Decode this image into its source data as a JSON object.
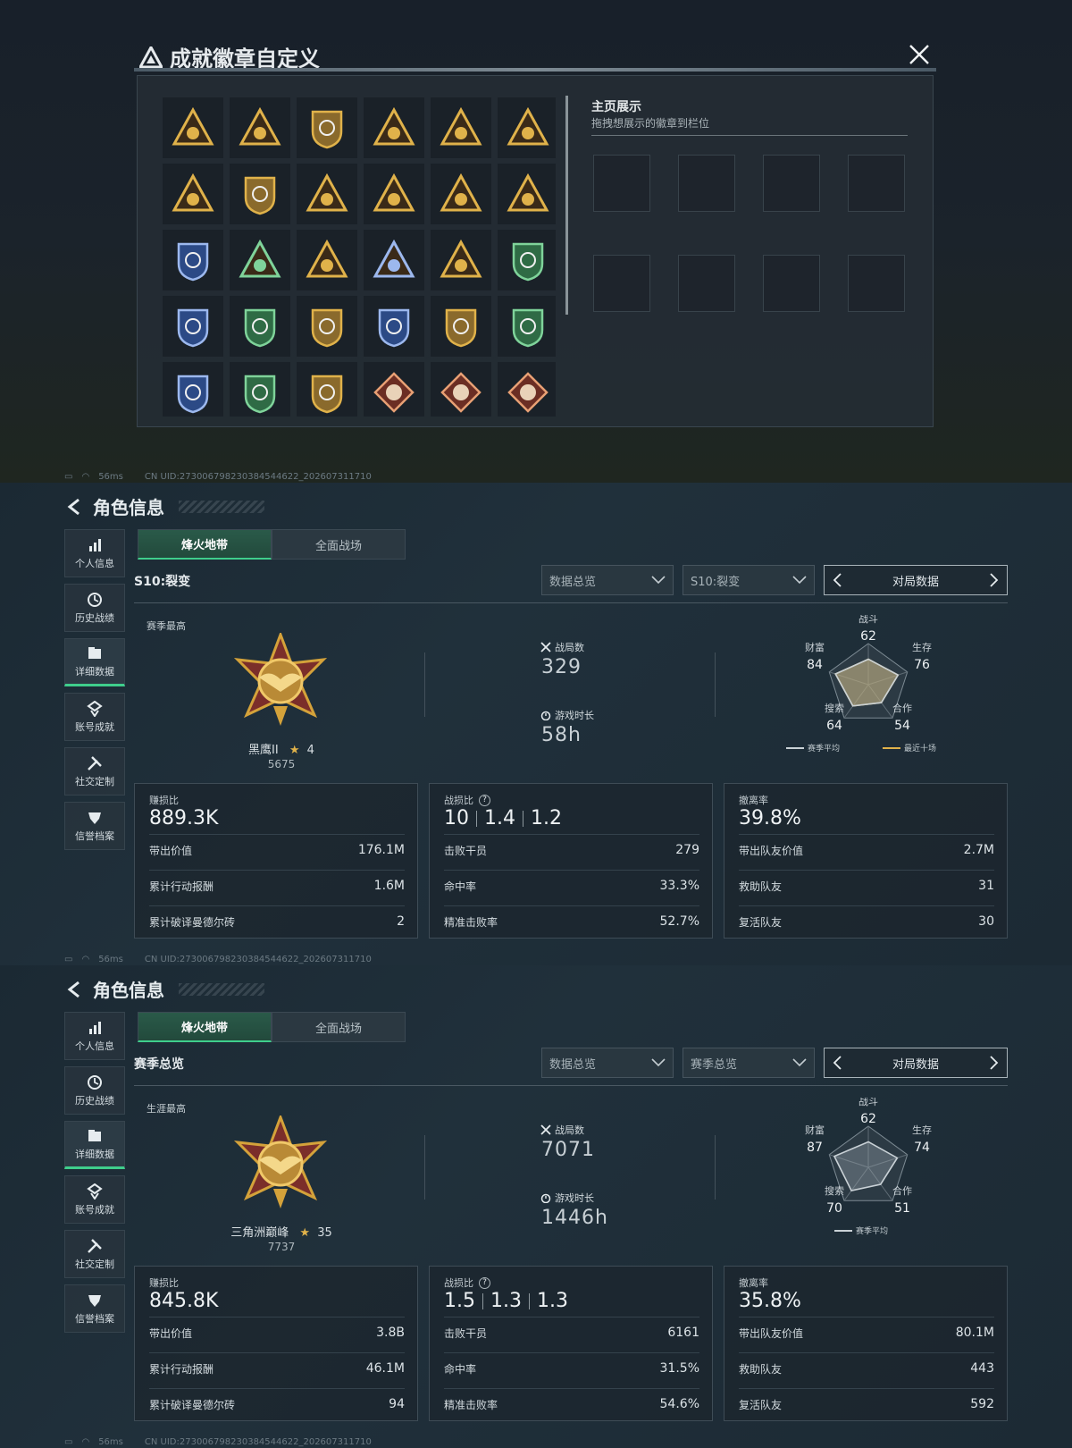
{
  "badge_modal": {
    "title": "成就徽章自定义",
    "home_title": "主页展示",
    "home_subtitle": "拖拽想展示的徽章到栏位",
    "badges": [
      "triangle-badge",
      "helicopter-badge",
      "crosshair-shield-badge",
      "sword-shield-badge",
      "eye-triangle-badge",
      "tank-triangle-badge",
      "backpack-triangle-badge",
      "doc-triangle-badge",
      "soldier-triangle-badge",
      "plane-triangle-badge",
      "gold-coins-badge",
      "helmet-triangle-badge",
      "rank-one-badge",
      "squad-triangle-badge",
      "diamond-crate-badge",
      "star-medal-badge",
      "green-rifle-badge",
      "blue-star-medal-badge",
      "white-shield-badge",
      "coins-round-badge",
      "gold-rifles-badge",
      "blue-rifles-badge",
      "green-rifles-badge",
      "green-rifles-2-badge",
      "green-cycle-badge",
      "green-cycle-2-badge",
      "gold-cycle-badge",
      "wolf-diamond-badge",
      "wolf-diamond-2-badge",
      "eagle-round-badge"
    ]
  },
  "status_bar": {
    "ping": "56ms",
    "uid": "CN UID:273006798230384544622_202607311710"
  },
  "panels": [
    {
      "page_title": "角色信息",
      "nav": [
        "个人信息",
        "历史战绩",
        "详细数据",
        "账号成就",
        "社交定制",
        "信誉档案"
      ],
      "active_nav": 2,
      "tabs": [
        "烽火地带",
        "全面战场"
      ],
      "section_title": "S10:裂变",
      "dropdown1": "数据总览",
      "dropdown2": "S10:裂变",
      "mode": "对局数据",
      "season_label": "赛季最高",
      "rank_name": "黑鹰II",
      "rank_stars": "4",
      "rank_points": "5675",
      "games_label": "战局数",
      "games": "329",
      "time_label": "游戏时长",
      "time": "58h",
      "radar": {
        "labels": [
          "战斗",
          "生存",
          "合作",
          "搜索",
          "财富"
        ],
        "avg": [
          62,
          76,
          54,
          64,
          84
        ],
        "recent": [
          62,
          76,
          54,
          64,
          84
        ],
        "legend_avg": "赛季平均",
        "legend_recent": "最近十场"
      },
      "cards": [
        {
          "label": "赚损比",
          "big": [
            "889.3K"
          ],
          "rows": [
            [
              "带出价值",
              "176.1M"
            ],
            [
              "累计行动报酬",
              "1.6M"
            ],
            [
              "累计破译曼德尔砖",
              "2"
            ]
          ]
        },
        {
          "label": "战损比",
          "help": "?",
          "big": [
            "10",
            "1.4",
            "1.2"
          ],
          "rows": [
            [
              "击败干员",
              "279"
            ],
            [
              "命中率",
              "33.3%"
            ],
            [
              "精准击败率",
              "52.7%"
            ]
          ]
        },
        {
          "label": "撤离率",
          "big": [
            "39.8%"
          ],
          "rows": [
            [
              "带出队友价值",
              "2.7M"
            ],
            [
              "救助队友",
              "31"
            ],
            [
              "复活队友",
              "30"
            ]
          ]
        }
      ]
    },
    {
      "page_title": "角色信息",
      "nav": [
        "个人信息",
        "历史战绩",
        "详细数据",
        "账号成就",
        "社交定制",
        "信誉档案"
      ],
      "active_nav": 2,
      "tabs": [
        "烽火地带",
        "全面战场"
      ],
      "section_title": "赛季总览",
      "dropdown1": "数据总览",
      "dropdown2": "赛季总览",
      "mode": "对局数据",
      "season_label": "生涯最高",
      "rank_name": "三角洲巅峰",
      "rank_stars": "35",
      "rank_points": "7737",
      "games_label": "战局数",
      "games": "7071",
      "time_label": "游戏时长",
      "time": "1446h",
      "radar": {
        "labels": [
          "战斗",
          "生存",
          "合作",
          "搜索",
          "财富"
        ],
        "avg": [
          62,
          74,
          51,
          70,
          87
        ],
        "legend_avg": "赛季平均"
      },
      "cards": [
        {
          "label": "赚损比",
          "big": [
            "845.8K"
          ],
          "rows": [
            [
              "带出价值",
              "3.8B"
            ],
            [
              "累计行动报酬",
              "46.1M"
            ],
            [
              "累计破译曼德尔砖",
              "94"
            ]
          ]
        },
        {
          "label": "战损比",
          "help": "?",
          "big": [
            "1.5",
            "1.3",
            "1.3"
          ],
          "rows": [
            [
              "击败干员",
              "6161"
            ],
            [
              "命中率",
              "31.5%"
            ],
            [
              "精准击败率",
              "54.6%"
            ]
          ]
        },
        {
          "label": "撤离率",
          "big": [
            "35.8%"
          ],
          "rows": [
            [
              "带出队友价值",
              "80.1M"
            ],
            [
              "救助队友",
              "443"
            ],
            [
              "复活队友",
              "592"
            ]
          ]
        }
      ]
    }
  ],
  "colors": {
    "accent": "#3fce8c",
    "gold": "#d4a23a",
    "radar_recent": "#e0b24a"
  }
}
